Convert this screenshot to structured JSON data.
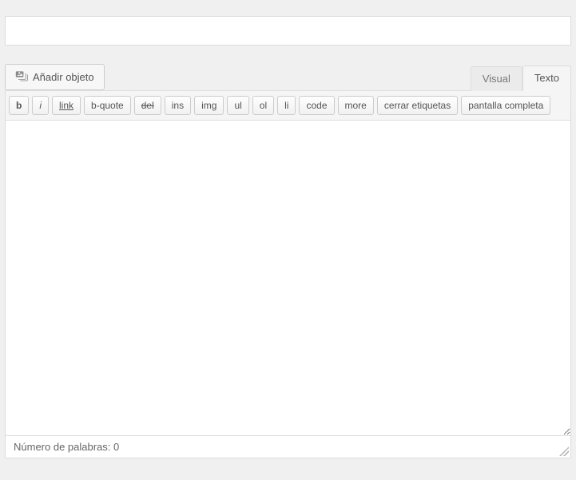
{
  "title": {
    "value": ""
  },
  "media_button": {
    "label": "Añadir objeto"
  },
  "tabs": {
    "visual": "Visual",
    "text": "Texto"
  },
  "quicktags": {
    "b": "b",
    "i": "i",
    "link": "link",
    "bquote": "b-quote",
    "del": "del",
    "ins": "ins",
    "img": "img",
    "ul": "ul",
    "ol": "ol",
    "li": "li",
    "code": "code",
    "more": "more",
    "close": "cerrar etiquetas",
    "fullscreen": "pantalla completa"
  },
  "editor": {
    "content": ""
  },
  "status": {
    "word_count_label": "Número de palabras: ",
    "word_count_value": "0"
  }
}
